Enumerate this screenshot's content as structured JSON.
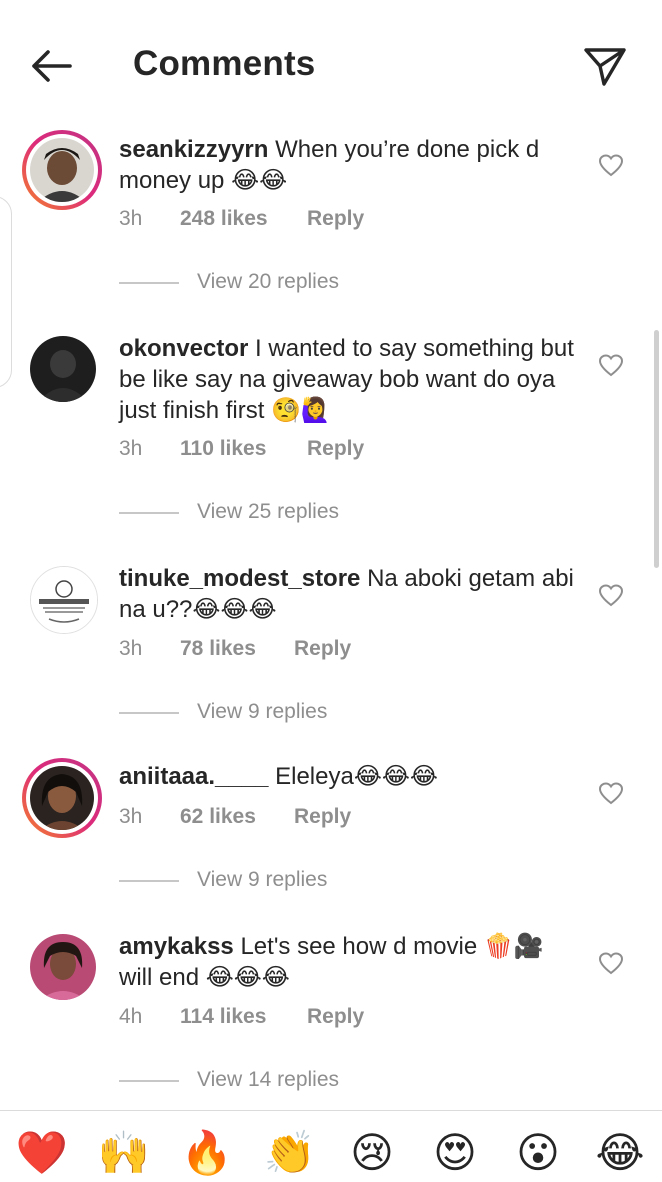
{
  "header": {
    "title": "Comments"
  },
  "comments": [
    {
      "username": "seankizzyyrn",
      "text": "When you’re done pick d money up 😂😂",
      "time": "3h",
      "likes": "248 likes",
      "reply": "Reply",
      "view_replies": "View 20 replies",
      "story_ring": true
    },
    {
      "username": "okonvector",
      "text": "I wanted to say something but be like say na giveaway bob want do oya just finish first 🧐🙋‍♀️",
      "time": "3h",
      "likes": "110 likes",
      "reply": "Reply",
      "view_replies": "View 25 replies",
      "story_ring": false
    },
    {
      "username": "tinuke_modest_store",
      "text": "Na aboki getam abi na u??😂😂😂",
      "time": "3h",
      "likes": "78 likes",
      "reply": "Reply",
      "view_replies": "View 9 replies",
      "story_ring": false
    },
    {
      "username": "aniitaaa.____",
      "text": "Eleleya😂😂😂",
      "time": "3h",
      "likes": "62 likes",
      "reply": "Reply",
      "view_replies": "View 9 replies",
      "story_ring": true
    },
    {
      "username": "amykakss",
      "text": "Let's see how d movie 🍿🎥 will end 😂😂😂",
      "time": "4h",
      "likes": "114 likes",
      "reply": "Reply",
      "view_replies": "View 14 replies",
      "story_ring": false
    }
  ],
  "emoji_bar": [
    "❤️",
    "🙌",
    "🔥",
    "👏",
    "😢",
    "😍",
    "😮",
    "😂"
  ],
  "colors": {
    "text": "#262626",
    "muted": "#8e8e8e",
    "divider": "#dbdbdb",
    "ring_start": "#f58529",
    "ring_end": "#c13584"
  }
}
